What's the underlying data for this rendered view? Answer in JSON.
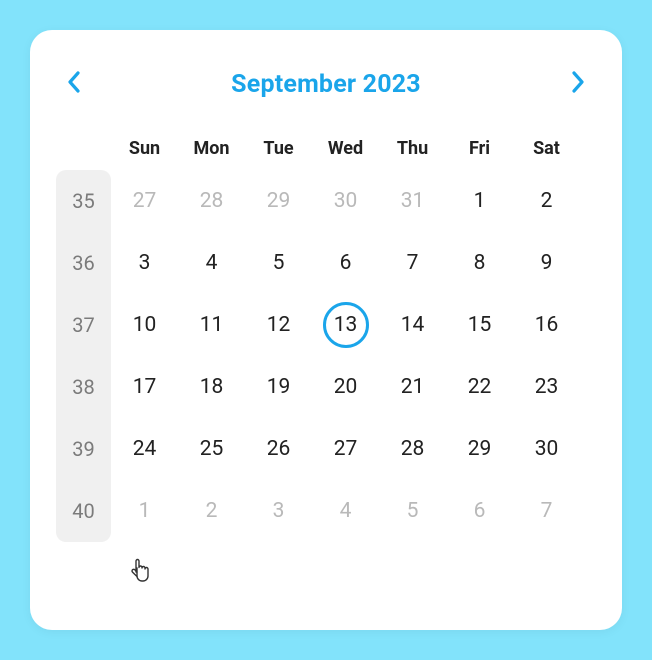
{
  "colors": {
    "accent": "#1aa5ea",
    "pageBg": "#82e3fb"
  },
  "header": {
    "title": "September 2023",
    "prevIcon": "chevron-left-icon",
    "nextIcon": "chevron-right-icon"
  },
  "dayHeaders": [
    "Sun",
    "Mon",
    "Tue",
    "Wed",
    "Thu",
    "Fri",
    "Sat"
  ],
  "weeks": [
    {
      "weekNo": "35",
      "days": [
        {
          "d": "27",
          "out": true
        },
        {
          "d": "28",
          "out": true
        },
        {
          "d": "29",
          "out": true
        },
        {
          "d": "30",
          "out": true
        },
        {
          "d": "31",
          "out": true
        },
        {
          "d": "1"
        },
        {
          "d": "2"
        }
      ]
    },
    {
      "weekNo": "36",
      "days": [
        {
          "d": "3"
        },
        {
          "d": "4"
        },
        {
          "d": "5"
        },
        {
          "d": "6"
        },
        {
          "d": "7"
        },
        {
          "d": "8"
        },
        {
          "d": "9"
        }
      ]
    },
    {
      "weekNo": "37",
      "days": [
        {
          "d": "10"
        },
        {
          "d": "11"
        },
        {
          "d": "12"
        },
        {
          "d": "13",
          "today": true
        },
        {
          "d": "14"
        },
        {
          "d": "15"
        },
        {
          "d": "16"
        }
      ]
    },
    {
      "weekNo": "38",
      "days": [
        {
          "d": "17"
        },
        {
          "d": "18"
        },
        {
          "d": "19"
        },
        {
          "d": "20"
        },
        {
          "d": "21"
        },
        {
          "d": "22"
        },
        {
          "d": "23"
        }
      ]
    },
    {
      "weekNo": "39",
      "days": [
        {
          "d": "24"
        },
        {
          "d": "25"
        },
        {
          "d": "26"
        },
        {
          "d": "27"
        },
        {
          "d": "28"
        },
        {
          "d": "29"
        },
        {
          "d": "30"
        }
      ]
    },
    {
      "weekNo": "40",
      "days": [
        {
          "d": "1",
          "out": true
        },
        {
          "d": "2",
          "out": true
        },
        {
          "d": "3",
          "out": true
        },
        {
          "d": "4",
          "out": true
        },
        {
          "d": "5",
          "out": true
        },
        {
          "d": "6",
          "out": true
        },
        {
          "d": "7",
          "out": true
        }
      ]
    }
  ],
  "cursor": {
    "icon": "pointer-cursor-icon"
  }
}
